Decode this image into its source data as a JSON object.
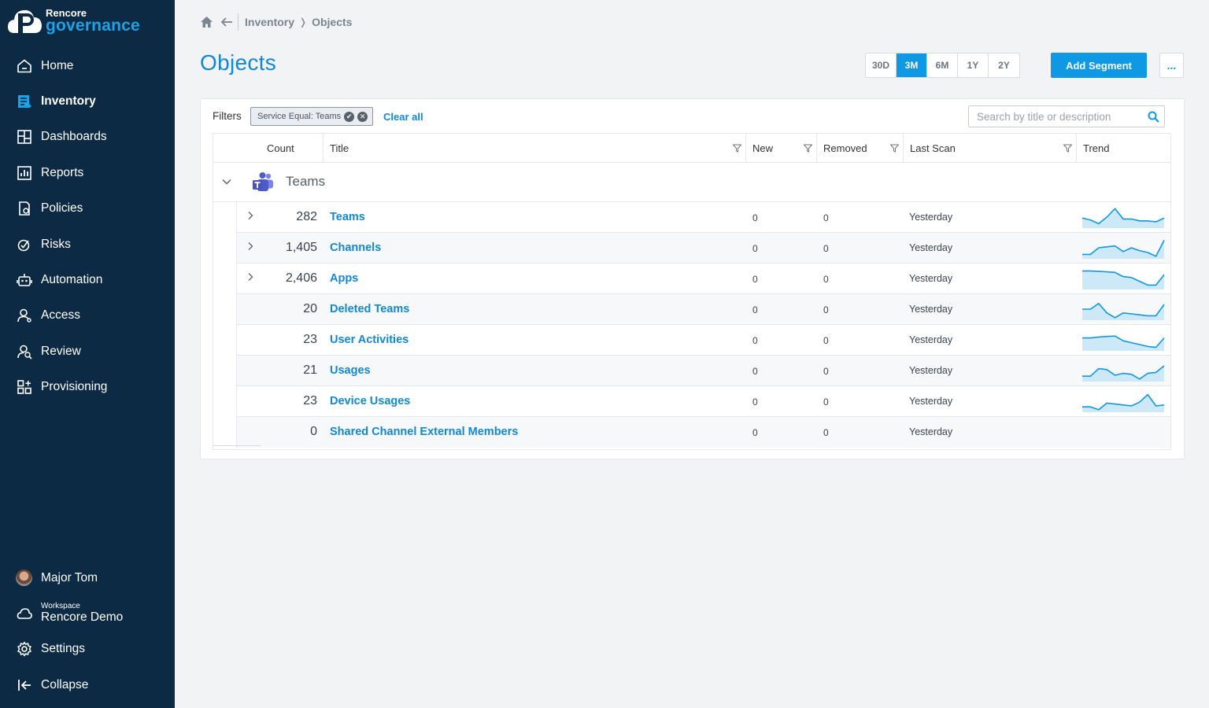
{
  "brand": {
    "line1": "Rencore",
    "line2": "governance"
  },
  "nav": [
    {
      "label": "Home",
      "icon": "home-icon",
      "active": false
    },
    {
      "label": "Inventory",
      "icon": "inventory-icon",
      "active": true
    },
    {
      "label": "Dashboards",
      "icon": "dashboards-icon",
      "active": false
    },
    {
      "label": "Reports",
      "icon": "reports-icon",
      "active": false
    },
    {
      "label": "Policies",
      "icon": "policies-icon",
      "active": false
    },
    {
      "label": "Risks",
      "icon": "risks-icon",
      "active": false
    },
    {
      "label": "Automation",
      "icon": "robot-icon",
      "active": false
    },
    {
      "label": "Access",
      "icon": "access-icon",
      "active": false
    },
    {
      "label": "Review",
      "icon": "review-icon",
      "active": false
    },
    {
      "label": "Provisioning",
      "icon": "provisioning-icon",
      "active": false
    }
  ],
  "user": {
    "name": "Major Tom"
  },
  "workspace": {
    "caption": "Workspace",
    "name": "Rencore Demo"
  },
  "settings_label": "Settings",
  "collapse_label": "Collapse",
  "breadcrumb": {
    "parent": "Inventory",
    "separator": "❭",
    "current": "Objects"
  },
  "page_title": "Objects",
  "ranges": [
    "30D",
    "3M",
    "6M",
    "1Y",
    "2Y"
  ],
  "active_range": "3M",
  "add_segment_label": "Add Segment",
  "more_label": "...",
  "filters": {
    "label": "Filters",
    "chip": "Service Equal: Teams",
    "clear_all": "Clear all",
    "search_placeholder": "Search by title or description"
  },
  "columns": {
    "count": "Count",
    "title": "Title",
    "new": "New",
    "removed": "Removed",
    "last_scan": "Last Scan",
    "trend": "Trend"
  },
  "group": {
    "title": "Teams"
  },
  "rows": [
    {
      "count": "282",
      "title": "Teams",
      "new": "0",
      "removed": "0",
      "last_scan": "Yesterday",
      "expandable": true,
      "trend": [
        0.45,
        0.35,
        0.15,
        0.5,
        0.95,
        0.4,
        0.4,
        0.3,
        0.3,
        0.25,
        0.45
      ]
    },
    {
      "count": "1,405",
      "title": "Channels",
      "new": "0",
      "removed": "0",
      "last_scan": "Yesterday",
      "expandable": true,
      "trend": [
        0.15,
        0.15,
        0.5,
        0.55,
        0.6,
        0.3,
        0.5,
        0.35,
        0.25,
        0.05,
        0.9
      ]
    },
    {
      "count": "2,406",
      "title": "Apps",
      "new": "0",
      "removed": "0",
      "last_scan": "Yesterday",
      "expandable": true,
      "trend": [
        0.9,
        0.9,
        0.88,
        0.85,
        0.82,
        0.6,
        0.55,
        0.35,
        0.15,
        0.15,
        0.7
      ]
    },
    {
      "count": "20",
      "title": "Deleted Teams",
      "new": "0",
      "removed": "0",
      "last_scan": "Yesterday",
      "expandable": false,
      "trend": [
        0.5,
        0.5,
        0.8,
        0.3,
        0.05,
        0.3,
        0.25,
        0.2,
        0.15,
        0.15,
        0.75
      ]
    },
    {
      "count": "23",
      "title": "User Activities",
      "new": "0",
      "removed": "0",
      "last_scan": "Yesterday",
      "expandable": false,
      "trend": [
        0.6,
        0.6,
        0.65,
        0.68,
        0.7,
        0.45,
        0.35,
        0.25,
        0.15,
        0.1,
        0.6
      ]
    },
    {
      "count": "21",
      "title": "Usages",
      "new": "0",
      "removed": "0",
      "last_scan": "Yesterday",
      "expandable": false,
      "trend": [
        0.2,
        0.2,
        0.6,
        0.55,
        0.25,
        0.35,
        0.3,
        0.05,
        0.35,
        0.4,
        0.75
      ]
    },
    {
      "count": "23",
      "title": "Device Usages",
      "new": "0",
      "removed": "0",
      "last_scan": "Yesterday",
      "expandable": false,
      "trend": [
        0.2,
        0.2,
        0.05,
        0.4,
        0.35,
        0.3,
        0.25,
        0.45,
        0.85,
        0.25,
        0.3
      ]
    },
    {
      "count": "0",
      "title": "Shared Channel External Members",
      "new": "0",
      "removed": "0",
      "last_scan": "Yesterday",
      "expandable": false,
      "trend": []
    }
  ],
  "colors": {
    "sidebar": "#0c2a43",
    "accent": "#0f98e4",
    "link": "#1287d6",
    "spark_fill": "#cde8f7"
  }
}
